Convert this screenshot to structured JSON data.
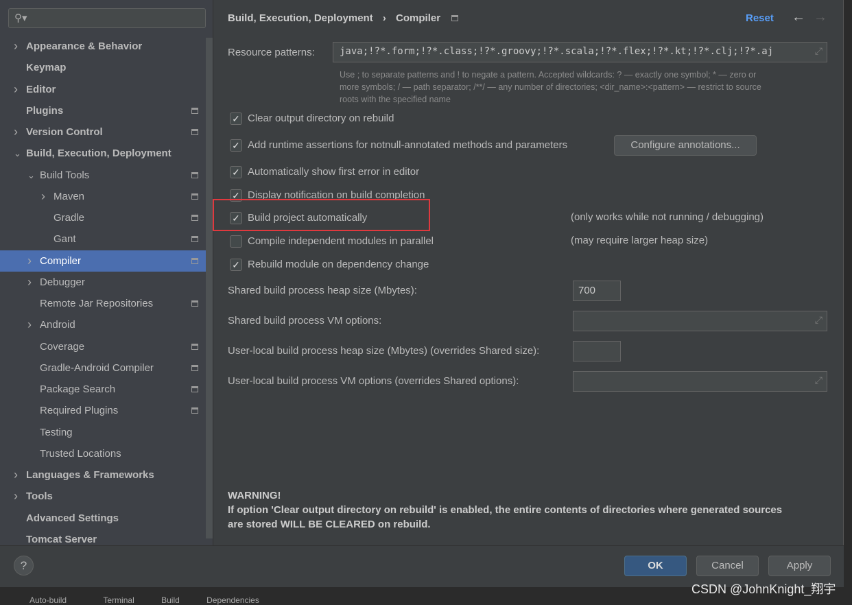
{
  "sidebar": {
    "search_placeholder": "",
    "items": [
      {
        "label": "Appearance & Behavior",
        "bold": true,
        "level": 0,
        "arrow": "right"
      },
      {
        "label": "Keymap",
        "bold": true,
        "level": 0
      },
      {
        "label": "Editor",
        "bold": true,
        "level": 0,
        "arrow": "right"
      },
      {
        "label": "Plugins",
        "bold": true,
        "level": 0,
        "page": true
      },
      {
        "label": "Version Control",
        "bold": true,
        "level": 0,
        "arrow": "right",
        "page": true
      },
      {
        "label": "Build, Execution, Deployment",
        "bold": true,
        "level": 0,
        "arrow": "down"
      },
      {
        "label": "Build Tools",
        "level": 1,
        "arrow": "down",
        "page": true
      },
      {
        "label": "Maven",
        "level": 2,
        "arrow": "right",
        "page": true
      },
      {
        "label": "Gradle",
        "level": 2,
        "page": true
      },
      {
        "label": "Gant",
        "level": 2,
        "page": true
      },
      {
        "label": "Compiler",
        "level": 1,
        "arrow": "right",
        "page": true,
        "selected": true
      },
      {
        "label": "Debugger",
        "level": 1,
        "arrow": "right"
      },
      {
        "label": "Remote Jar Repositories",
        "level": 1,
        "page": true
      },
      {
        "label": "Android",
        "level": 1,
        "arrow": "right"
      },
      {
        "label": "Coverage",
        "level": 1,
        "page": true
      },
      {
        "label": "Gradle-Android Compiler",
        "level": 1,
        "page": true
      },
      {
        "label": "Package Search",
        "level": 1,
        "page": true
      },
      {
        "label": "Required Plugins",
        "level": 1,
        "page": true
      },
      {
        "label": "Testing",
        "level": 1
      },
      {
        "label": "Trusted Locations",
        "level": 1
      },
      {
        "label": "Languages & Frameworks",
        "bold": true,
        "level": 0,
        "arrow": "right"
      },
      {
        "label": "Tools",
        "bold": true,
        "level": 0,
        "arrow": "right"
      },
      {
        "label": "Advanced Settings",
        "bold": true,
        "level": 0
      },
      {
        "label": "Tomcat Server",
        "bold": true,
        "level": 0
      }
    ]
  },
  "header": {
    "breadcrumb_parent": "Build, Execution, Deployment",
    "breadcrumb_sep": "›",
    "breadcrumb_current": "Compiler",
    "reset": "Reset",
    "back": "←",
    "forward": "→"
  },
  "compiler": {
    "resource_label": "Resource patterns:",
    "resource_value": "java;!?*.form;!?*.class;!?*.groovy;!?*.scala;!?*.flex;!?*.kt;!?*.clj;!?*.aj",
    "help_line1": "Use ; to separate patterns and ! to negate a pattern. Accepted wildcards: ? — exactly one symbol; * — zero or",
    "help_line2": "more symbols; / — path separator; /**/ — any number of directories; <dir_name>:<pattern> — restrict to source",
    "help_line3": "roots with the specified name",
    "options": [
      {
        "label": "Clear output directory on rebuild",
        "checked": true
      },
      {
        "label": "Add runtime assertions for notnull-annotated methods and parameters",
        "checked": true
      },
      {
        "label": "Automatically show first error in editor",
        "checked": true
      },
      {
        "label": "Display notification on build completion",
        "checked": true
      },
      {
        "label": "Build project automatically",
        "checked": true,
        "note": "(only works while not running / debugging)"
      },
      {
        "label": "Compile independent modules in parallel",
        "checked": false,
        "note": "(may require larger heap size)"
      },
      {
        "label": "Rebuild module on dependency change",
        "checked": true
      }
    ],
    "configure_annotations": "Configure annotations...",
    "heap_label": "Shared build process heap size (Mbytes):",
    "heap_value": "700",
    "vm_label": "Shared build process VM options:",
    "vm_value": "",
    "local_heap_label": "User-local build process heap size (Mbytes) (overrides Shared size):",
    "local_heap_value": "",
    "local_vm_label": "User-local build process VM options (overrides Shared options):",
    "local_vm_value": "",
    "warning_title": "WARNING!",
    "warning_line1": "If option 'Clear output directory on rebuild' is enabled, the entire contents of directories where generated sources",
    "warning_line2": "are stored WILL BE CLEARED on rebuild.",
    "highlight_color": "#e0393e"
  },
  "footer": {
    "help": "?",
    "ok": "OK",
    "cancel": "Cancel",
    "apply": "Apply"
  },
  "watermark": "CSDN @JohnKnight_翔宇",
  "taskbar": [
    "Auto-build",
    "Terminal",
    "Build",
    "Dependencies"
  ],
  "colors": {
    "selected": "#4b6eaf",
    "accent": "#589df6",
    "ok_button": "#365880"
  }
}
